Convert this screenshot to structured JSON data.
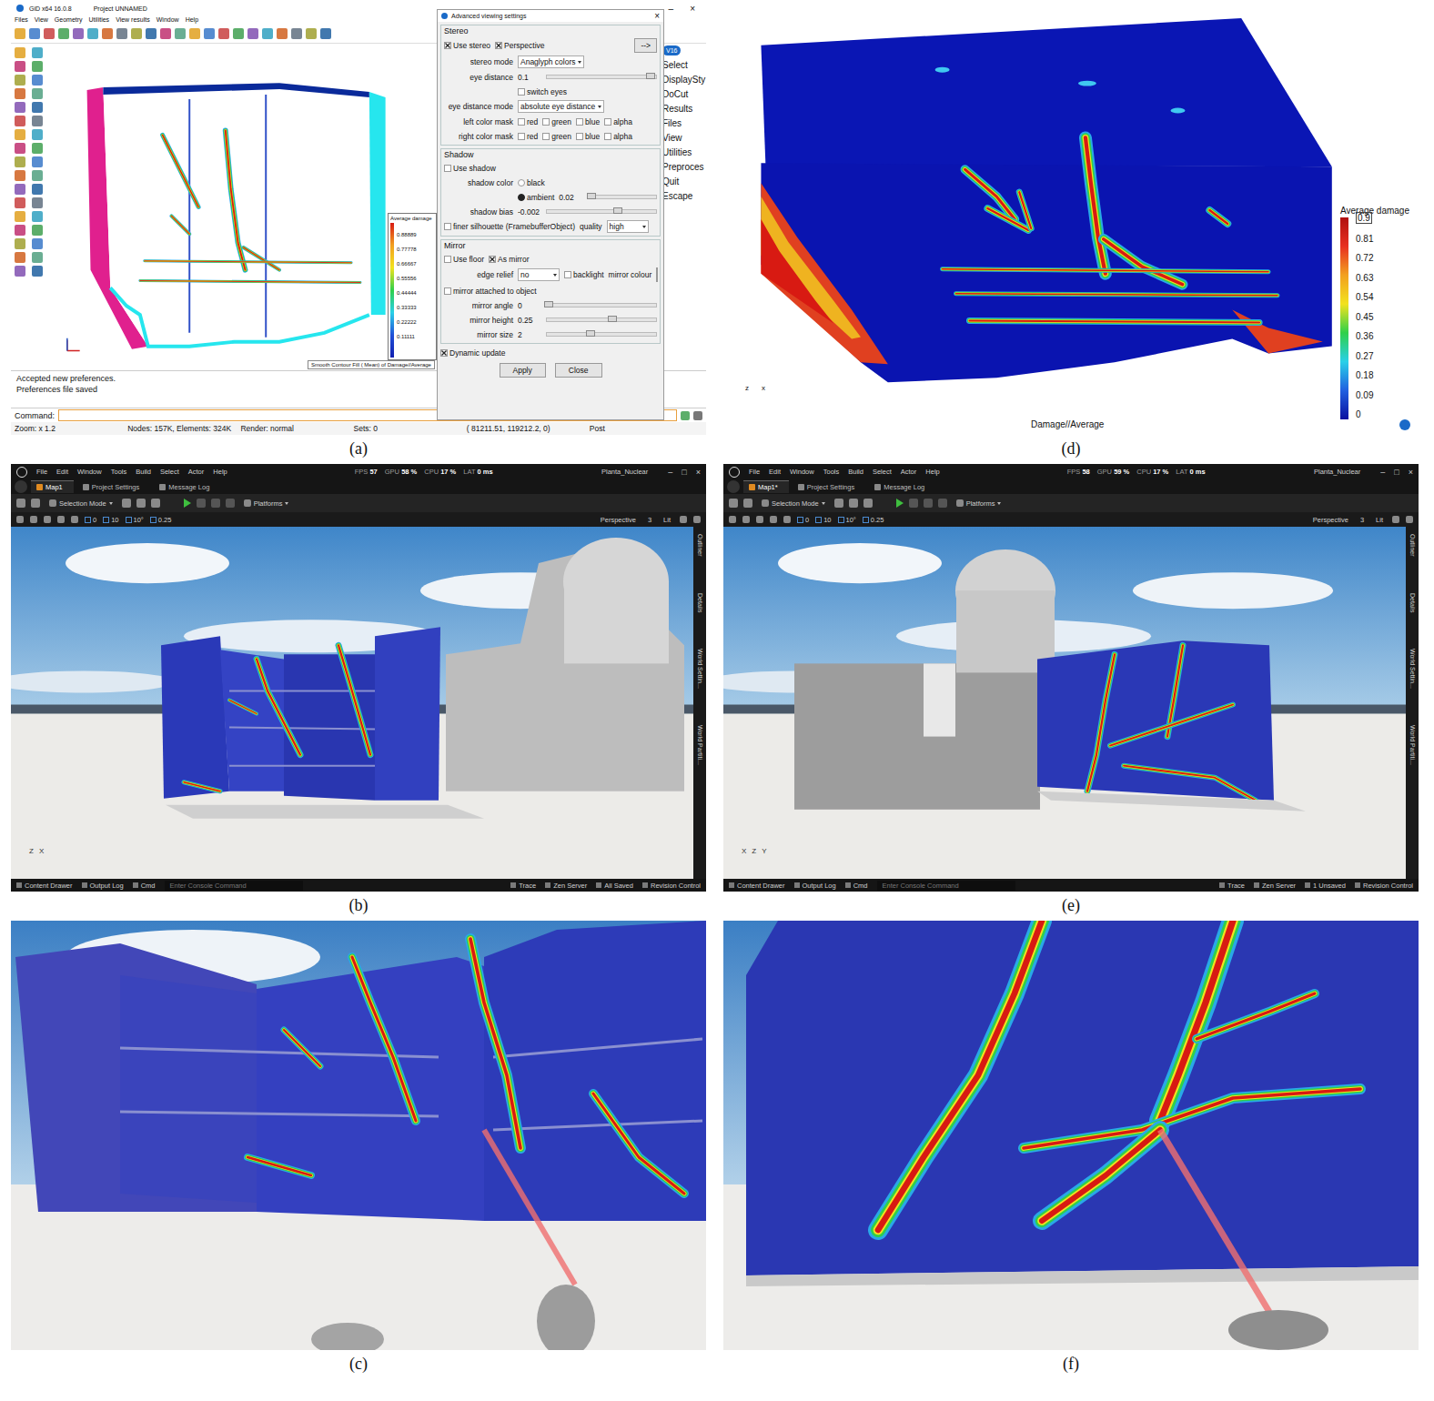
{
  "gid_window": {
    "label": "(a)",
    "title": "GiD x64 16.0.8",
    "project": "Project UNNAMED",
    "window_controls": [
      "–",
      "×"
    ],
    "menu": [
      "Files",
      "View",
      "Geometry",
      "Utilities",
      "View results",
      "Window",
      "Help"
    ],
    "badge": "V16",
    "side_menu": [
      "Select",
      "DisplaySty",
      "DoCut",
      "Results",
      "Files",
      "View",
      "Utilities",
      "Preproces",
      "Quit",
      "Escape"
    ],
    "legend": {
      "title": "Average damage",
      "values": [
        "0.88889",
        "0.77778",
        "0.66667",
        "0.55556",
        "0.44444",
        "0.33333",
        "0.22222",
        "0.11111"
      ],
      "caption": "Smooth Contour Fill ( Mean) of Damage//Average"
    },
    "messages": [
      "Accepted new preferences.",
      "Preferences file saved"
    ],
    "command_label": "Command:",
    "status": [
      "Zoom: x 1.2",
      "Nodes: 157K, Elements: 324K",
      "Render: normal",
      "Sets: 0",
      "( 81211.51,  119212.2,  0)",
      "Post"
    ]
  },
  "viewing_dialog": {
    "title": "Advanced viewing settings",
    "close": "×",
    "sections": [
      {
        "title": "Stereo",
        "rows": [
          {
            "items": [
              {
                "kind": "check",
                "label": "Use stereo",
                "checked": true
              },
              {
                "kind": "check",
                "label": "Perspective",
                "checked": true
              },
              {
                "kind": "button",
                "label": "-->"
              }
            ]
          },
          {
            "label": "stereo mode",
            "items": [
              {
                "kind": "dropdown",
                "value": "Anaglyph colors"
              }
            ]
          },
          {
            "label": "eye distance",
            "items": [
              {
                "kind": "value",
                "text": "0.1"
              },
              {
                "kind": "slider",
                "level": 0.95
              }
            ]
          },
          {
            "label": null,
            "items": [
              {
                "kind": "check",
                "label": "switch eyes",
                "checked": false
              }
            ]
          },
          {
            "label": "eye distance mode",
            "items": [
              {
                "kind": "dropdown",
                "value": "absolute eye distance"
              }
            ]
          },
          {
            "label": "left color mask",
            "items": [
              {
                "kind": "check",
                "label": "red",
                "checked": false
              },
              {
                "kind": "check",
                "label": "green",
                "checked": false
              },
              {
                "kind": "check",
                "label": "blue",
                "checked": false
              },
              {
                "kind": "check",
                "label": "alpha",
                "checked": false
              }
            ]
          },
          {
            "label": "right color mask",
            "items": [
              {
                "kind": "check",
                "label": "red",
                "checked": false
              },
              {
                "kind": "check",
                "label": "green",
                "checked": false
              },
              {
                "kind": "check",
                "label": "blue",
                "checked": false
              },
              {
                "kind": "check",
                "label": "alpha",
                "checked": false
              }
            ]
          }
        ]
      },
      {
        "title": "Shadow",
        "rows": [
          {
            "items": [
              {
                "kind": "check",
                "label": "Use shadow",
                "checked": false
              }
            ]
          },
          {
            "label": "shadow color",
            "items": [
              {
                "kind": "radio",
                "label": "black",
                "selected": false
              }
            ]
          },
          {
            "label": null,
            "items": [
              {
                "kind": "radio",
                "label": "ambient",
                "selected": true
              },
              {
                "kind": "value",
                "text": "0.02"
              },
              {
                "kind": "slider",
                "level": 0.05
              }
            ]
          },
          {
            "label": "shadow bias",
            "items": [
              {
                "kind": "value",
                "text": "-0.002"
              },
              {
                "kind": "slider",
                "level": 0.65
              }
            ]
          },
          {
            "items": [
              {
                "kind": "check",
                "label": "finer silhouette (FramebufferObject)",
                "checked": false
              },
              {
                "kind": "text",
                "text": "quality"
              },
              {
                "kind": "dropdown",
                "value": "high"
              }
            ]
          }
        ]
      },
      {
        "title": "Mirror",
        "rows": [
          {
            "items": [
              {
                "kind": "check",
                "label": "Use floor",
                "checked": false
              },
              {
                "kind": "check",
                "label": "As mirror",
                "checked": true
              }
            ]
          },
          {
            "label": "edge relief",
            "items": [
              {
                "kind": "dropdown",
                "value": "no"
              },
              {
                "kind": "check",
                "label": "backlight",
                "checked": false
              },
              {
                "kind": "text",
                "text": "mirror colour"
              },
              {
                "kind": "swatch",
                "color": "#cfe1f3"
              }
            ]
          },
          {
            "items": [
              {
                "kind": "check",
                "label": "mirror attached to object",
                "checked": false
              }
            ]
          },
          {
            "label": "mirror angle",
            "items": [
              {
                "kind": "value",
                "text": "0"
              },
              {
                "kind": "slider",
                "level": 0.02
              }
            ]
          },
          {
            "label": "mirror height",
            "items": [
              {
                "kind": "value",
                "text": "0.25"
              },
              {
                "kind": "slider",
                "level": 0.6
              }
            ]
          },
          {
            "label": "mirror size",
            "items": [
              {
                "kind": "value",
                "text": "2"
              },
              {
                "kind": "slider",
                "level": 0.4
              }
            ]
          }
        ]
      }
    ],
    "dynamic_update": {
      "label": "Dynamic update",
      "checked": true
    },
    "buttons": [
      "Apply",
      "Close"
    ]
  },
  "gid_render": {
    "label": "(d)",
    "legend_title": "Average damage",
    "legend_values": [
      "0.9",
      "0.81",
      "0.72",
      "0.63",
      "0.54",
      "0.45",
      "0.36",
      "0.27",
      "0.18",
      "0.09",
      "0"
    ],
    "caption": "Damage//Average",
    "axes": [
      "z",
      "x"
    ]
  },
  "unreal_views": [
    {
      "label": "(b)",
      "menu": [
        "File",
        "Edit",
        "Window",
        "Tools",
        "Build",
        "Select",
        "Actor",
        "Help"
      ],
      "stats": [
        {
          "name": "FPS",
          "value": "57"
        },
        {
          "name": "GPU",
          "value": "58 %"
        },
        {
          "name": "CPU",
          "value": "17 %"
        },
        {
          "name": "LAT",
          "value": "0 ms"
        }
      ],
      "project": "Planta_Nuclear",
      "window_controls": [
        "–",
        "□",
        "×"
      ],
      "tabs": [
        {
          "label": "Map1",
          "selected": true
        },
        {
          "label": "Project Settings",
          "selected": false
        },
        {
          "label": "Message Log",
          "selected": false
        }
      ],
      "mode": "Selection Mode",
      "platforms": "Platforms",
      "snaps": [
        "0",
        "10",
        "10°",
        "0.25"
      ],
      "view": [
        "Perspective",
        "3",
        "Lit"
      ],
      "side_tabs": [
        "Outliner",
        "Details",
        "World Settin...",
        "World Partiti..."
      ],
      "bottom_left": [
        "Content Drawer",
        "Output Log",
        "Cmd"
      ],
      "console_placeholder": "Enter Console Command",
      "bottom_right": [
        "Trace",
        "Zen Server",
        "All Saved",
        "Revision Control"
      ],
      "axes": [
        "Z",
        "X"
      ]
    },
    {
      "label": "(e)",
      "menu": [
        "File",
        "Edit",
        "Window",
        "Tools",
        "Build",
        "Select",
        "Actor",
        "Help"
      ],
      "stats": [
        {
          "name": "FPS",
          "value": "58"
        },
        {
          "name": "GPU",
          "value": "59 %"
        },
        {
          "name": "CPU",
          "value": "17 %"
        },
        {
          "name": "LAT",
          "value": "0 ms"
        }
      ],
      "project": "Planta_Nuclear",
      "window_controls": [
        "–",
        "□",
        "×"
      ],
      "tabs": [
        {
          "label": "Map1*",
          "selected": true
        },
        {
          "label": "Project Settings",
          "selected": false
        },
        {
          "label": "Message Log",
          "selected": false
        }
      ],
      "mode": "Selection Mode",
      "platforms": "Platforms",
      "snaps": [
        "0",
        "10",
        "10°",
        "0.25"
      ],
      "view": [
        "Perspective",
        "3",
        "Lit"
      ],
      "side_tabs": [
        "Outliner",
        "Details",
        "World Settin...",
        "World Partiti..."
      ],
      "bottom_left": [
        "Content Drawer",
        "Output Log",
        "Cmd"
      ],
      "console_placeholder": "Enter Console Command",
      "bottom_right": [
        "Trace",
        "Zen Server",
        "1 Unsaved",
        "Revision Control"
      ],
      "axes": [
        "X",
        "Z",
        "Y"
      ]
    }
  ],
  "vr_views": [
    {
      "label": "(c)"
    },
    {
      "label": "(f)"
    }
  ]
}
